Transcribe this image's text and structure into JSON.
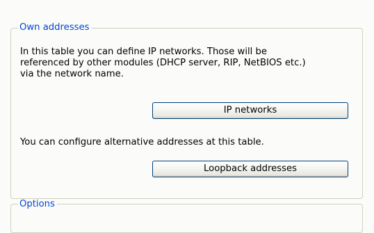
{
  "own_addresses": {
    "legend": "Own addresses",
    "description_lines": [
      "In this table you can define IP networks. Those will be",
      "referenced by other modules (DHCP server, RIP, NetBIOS etc.)",
      "via the network name."
    ],
    "ip_networks_button": "IP networks",
    "alternative_text": "You can configure alternative addresses at this table.",
    "loopback_button": "Loopback addresses"
  },
  "options": {
    "legend": "Options"
  },
  "colors": {
    "legend_text": "#0046d5",
    "group_border": "#d0d0bf",
    "button_border": "#003c74",
    "background": "#fbfbf9"
  }
}
